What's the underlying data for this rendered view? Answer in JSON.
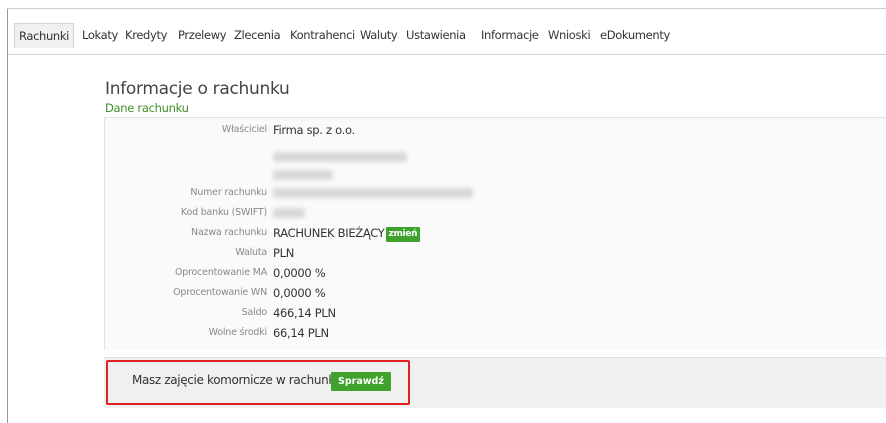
{
  "nav": {
    "items": [
      {
        "label": "Rachunki",
        "active": true
      },
      {
        "label": "Lokaty"
      },
      {
        "label": "Kredyty"
      },
      {
        "label": "Przelewy"
      },
      {
        "label": "Zlecenia"
      },
      {
        "label": "Kontrahenci"
      },
      {
        "label": "Waluty"
      },
      {
        "label": "Ustawienia"
      },
      {
        "label": "Informacje"
      },
      {
        "label": "Wnioski"
      },
      {
        "label": "eDokumenty"
      }
    ]
  },
  "page": {
    "title": "Informacje o rachunku",
    "section_title": "Dane rachunku"
  },
  "account": {
    "owner_label": "Właściciel",
    "owner_value": "Firma sp. z o.o.",
    "number_label": "Numer rachunku",
    "swift_label": "Kod banku (SWIFT)",
    "name_label": "Nazwa rachunku",
    "name_value": "RACHUNEK BIEŻĄCY",
    "change_button": "zmień",
    "currency_label": "Waluta",
    "currency_value": "PLN",
    "rate_ma_label": "Oprocentowanie MA",
    "rate_ma_value": "0,0000 %",
    "rate_wn_label": "Oprocentowanie WN",
    "rate_wn_value": "0,0000 %",
    "balance_label": "Saldo",
    "balance_value": "466,14 PLN",
    "available_label": "Wolne środki",
    "available_value": "66,14 PLN"
  },
  "notice": {
    "text": "Masz zajęcie komornicze w rachunku",
    "button": "Sprawdź"
  },
  "colors": {
    "accent_green": "#3fa22d",
    "highlight_red": "#e02121"
  }
}
